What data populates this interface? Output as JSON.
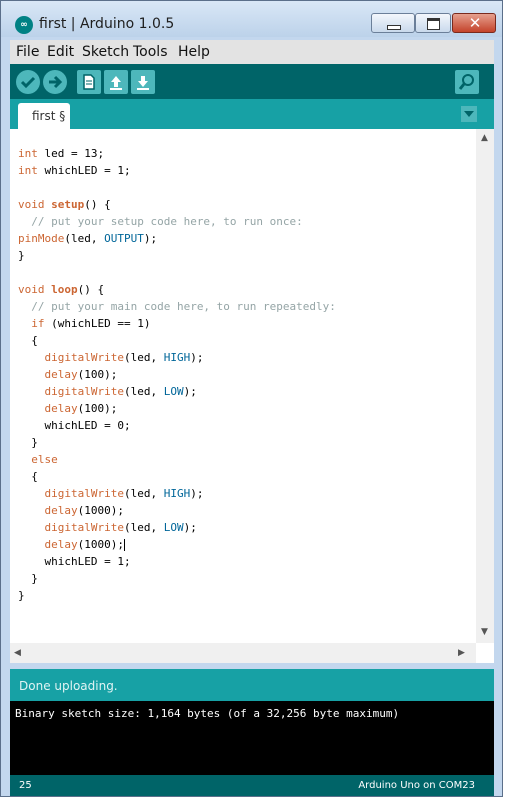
{
  "window": {
    "title": "first | Arduino 1.0.5",
    "close_glyph": "✕"
  },
  "menu": [
    "File",
    "Edit",
    "Sketch",
    "Tools",
    "Help"
  ],
  "toolbar": {
    "buttons": [
      "verify-icon",
      "upload-icon",
      "new-icon",
      "open-icon",
      "save-icon"
    ],
    "right": "serial-monitor-icon"
  },
  "tab": {
    "label": "first §",
    "menu_icon": "chevron-down-icon"
  },
  "code": [
    [
      [
        "kw",
        "int"
      ],
      [
        "n",
        " led = 13;"
      ]
    ],
    [
      [
        "kw",
        "int"
      ],
      [
        "n",
        " whichLED = 1;"
      ]
    ],
    [],
    [
      [
        "kw",
        "void"
      ],
      [
        "n",
        " "
      ],
      [
        "kwb",
        "setup"
      ],
      [
        "n",
        "() {"
      ]
    ],
    [
      [
        "n",
        "  "
      ],
      [
        "cmt",
        "// put your setup code here, to run once:"
      ]
    ],
    [
      [
        "kw",
        "pinMode"
      ],
      [
        "n",
        "(led, "
      ],
      [
        "const",
        "OUTPUT"
      ],
      [
        "n",
        ");"
      ]
    ],
    [
      [
        "n",
        "}"
      ]
    ],
    [],
    [
      [
        "kw",
        "void"
      ],
      [
        "n",
        " "
      ],
      [
        "kwb",
        "loop"
      ],
      [
        "n",
        "() {"
      ]
    ],
    [
      [
        "n",
        "  "
      ],
      [
        "cmt",
        "// put your main code here, to run repeatedly:"
      ]
    ],
    [
      [
        "n",
        "  "
      ],
      [
        "kw",
        "if"
      ],
      [
        "n",
        " (whichLED == 1)"
      ]
    ],
    [
      [
        "n",
        "  {"
      ]
    ],
    [
      [
        "n",
        "    "
      ],
      [
        "kw",
        "digitalWrite"
      ],
      [
        "n",
        "(led, "
      ],
      [
        "const",
        "HIGH"
      ],
      [
        "n",
        ");"
      ]
    ],
    [
      [
        "n",
        "    "
      ],
      [
        "kw",
        "delay"
      ],
      [
        "n",
        "(100);"
      ]
    ],
    [
      [
        "n",
        "    "
      ],
      [
        "kw",
        "digitalWrite"
      ],
      [
        "n",
        "(led, "
      ],
      [
        "const",
        "LOW"
      ],
      [
        "n",
        ");"
      ]
    ],
    [
      [
        "n",
        "    "
      ],
      [
        "kw",
        "delay"
      ],
      [
        "n",
        "(100);"
      ]
    ],
    [
      [
        "n",
        "    whichLED = 0;"
      ]
    ],
    [
      [
        "n",
        "  }"
      ]
    ],
    [
      [
        "n",
        "  "
      ],
      [
        "kw",
        "else"
      ]
    ],
    [
      [
        "n",
        "  {"
      ]
    ],
    [
      [
        "n",
        "    "
      ],
      [
        "kw",
        "digitalWrite"
      ],
      [
        "n",
        "(led, "
      ],
      [
        "const",
        "HIGH"
      ],
      [
        "n",
        ");"
      ]
    ],
    [
      [
        "n",
        "    "
      ],
      [
        "kw",
        "delay"
      ],
      [
        "n",
        "(1000);"
      ]
    ],
    [
      [
        "n",
        "    "
      ],
      [
        "kw",
        "digitalWrite"
      ],
      [
        "n",
        "(led, "
      ],
      [
        "const",
        "LOW"
      ],
      [
        "n",
        ");"
      ]
    ],
    [
      [
        "n",
        "    "
      ],
      [
        "kw",
        "delay"
      ],
      [
        "n",
        "(1000);"
      ],
      [
        "caret",
        ""
      ]
    ],
    [
      [
        "n",
        "    whichLED = 1;"
      ]
    ],
    [
      [
        "n",
        "  }"
      ]
    ],
    [
      [
        "n",
        "}"
      ]
    ]
  ],
  "status": {
    "message": "Done uploading."
  },
  "console": {
    "output": "Binary sketch size: 1,164 bytes (of a 32,256 byte maximum)"
  },
  "footer": {
    "line_number": "25",
    "board": "Arduino Uno on COM23"
  },
  "colors": {
    "teal_dark": "#006468",
    "teal": "#17a1a5",
    "keyword": "#cc6633",
    "constant": "#006699",
    "comment": "#95a5a6"
  }
}
